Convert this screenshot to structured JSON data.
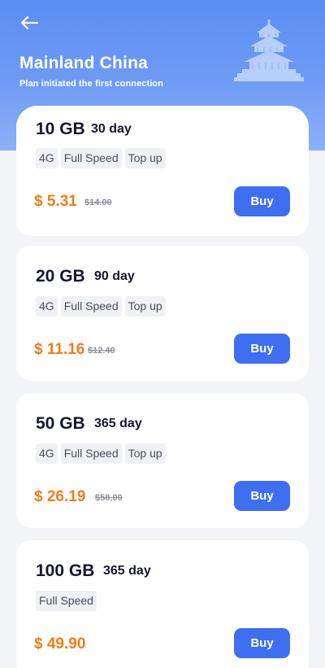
{
  "header": {
    "title": "Mainland China",
    "subtitle": "Plan initiated the first connection"
  },
  "plans": [
    {
      "size": "10 GB",
      "duration": "30 day",
      "tags": [
        "4G",
        "Full Speed",
        "Top up"
      ],
      "price": "$ 5.31",
      "original_price": "$14.00",
      "buy_label": "Buy"
    },
    {
      "size": "20 GB",
      "duration": "90 day",
      "tags": [
        "4G",
        "Full Speed",
        "Top up"
      ],
      "price": "$ 11.16",
      "original_price": "$12.40",
      "buy_label": "Buy"
    },
    {
      "size": "50 GB",
      "duration": "365 day",
      "tags": [
        "4G",
        "Full Speed",
        "Top up"
      ],
      "price": "$ 26.19",
      "original_price": "$58.00",
      "buy_label": "Buy"
    },
    {
      "size": "100 GB",
      "duration": "365 day",
      "tags": [
        "Full Speed"
      ],
      "price": "$ 49.90",
      "original_price": "",
      "buy_label": "Buy"
    }
  ],
  "colors": {
    "header_gradient_top": "#5b8df2",
    "header_gradient_bottom": "#8db1f8",
    "price_orange": "#f07d17",
    "buy_button_blue": "#3d6ff0",
    "text_dark": "#15172e"
  },
  "icons": {
    "back": "back-arrow-icon",
    "header_decoration": "temple-of-heaven-icon"
  }
}
